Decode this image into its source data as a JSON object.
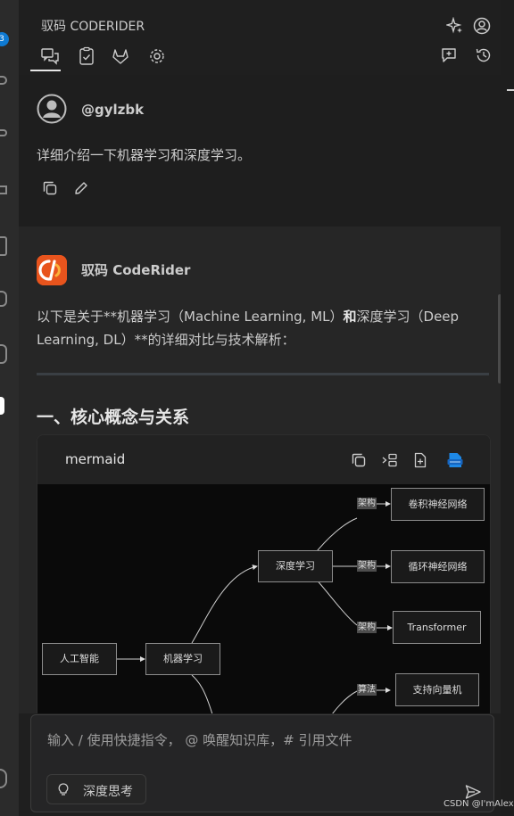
{
  "header": {
    "title": "驭码 CODERIDER"
  },
  "user_message": {
    "username": "@gylzbk",
    "text": "详细介绍一下机器学习和深度学习。"
  },
  "assistant_message": {
    "name": "驭码 CodeRider",
    "intro_part1": "以下是关于**机器学习（Machine Learning, ML）",
    "intro_bold": "和",
    "intro_part2": "深度学习（Deep Learning, DL）**的详细对比与技术解析：",
    "section_heading": "一、核心概念与关系",
    "code_block": {
      "language": "mermaid"
    }
  },
  "diagram": {
    "nodes": {
      "ai": "人工智能",
      "ml": "机器学习",
      "dl": "深度学习",
      "cnn": "卷积神经网络",
      "rnn": "循环神经网络",
      "transformer": "Transformer",
      "svm": "支持向量机"
    },
    "edge_labels": {
      "arch1": "架构",
      "arch2": "架构",
      "arch3": "架构",
      "algo": "算法"
    }
  },
  "input": {
    "placeholder": "输入 / 使用快捷指令， @ 唤醒知识库，# 引用文件",
    "deep_think_label": "深度思考"
  },
  "activity_bar": {
    "badge_count": "3"
  },
  "watermark": "CSDN @I'mAlex"
}
